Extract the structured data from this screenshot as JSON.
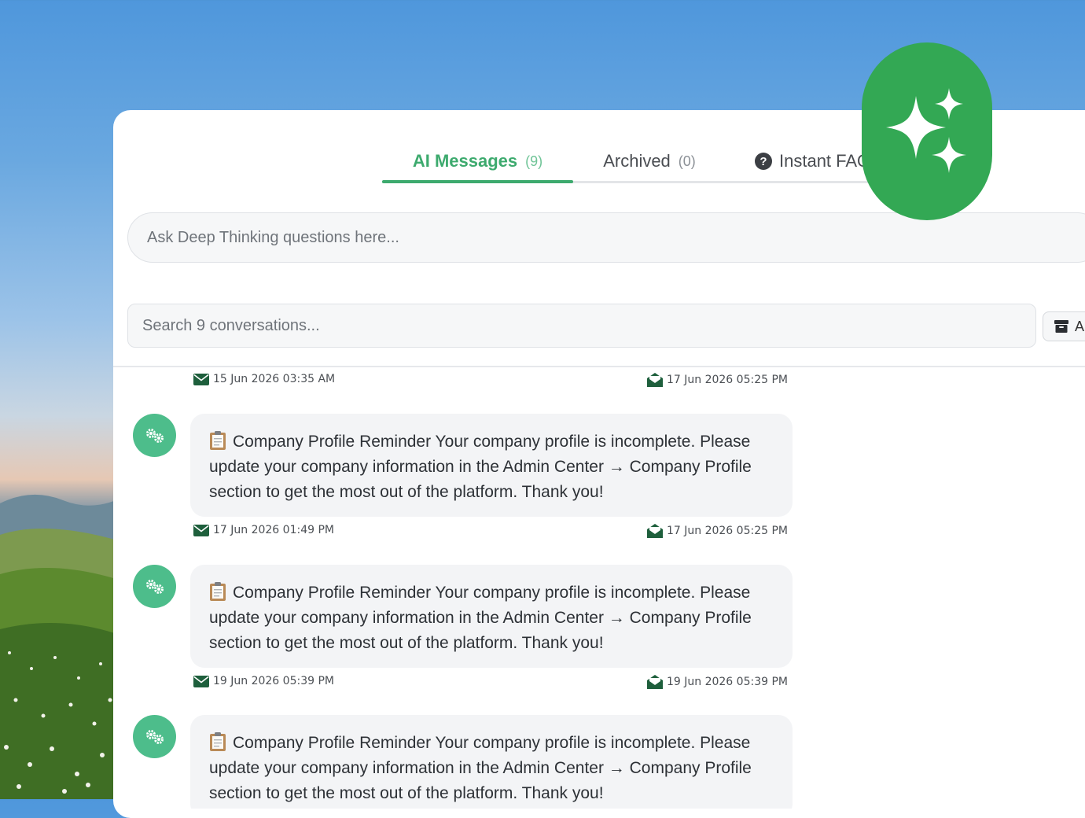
{
  "tabs": [
    {
      "label": "AI Messages",
      "count": "(9)"
    },
    {
      "label": "Archived",
      "count": "(0)"
    },
    {
      "label": "Instant FAQ"
    }
  ],
  "ask": {
    "placeholder": "Ask Deep Thinking questions here..."
  },
  "search": {
    "placeholder": "Search 9 conversations..."
  },
  "archive_button": {
    "label": "A"
  },
  "messages": [
    {
      "sent": "15 Jun 2026 03:35 AM",
      "read": "17 Jun 2026 05:25 PM"
    },
    {
      "text": "Company Profile Reminder Your company profile is incomplete. Please update your company information in the Admin Center → Company Profile section to get the most out of the platform. Thank you!",
      "sent": "17 Jun 2026 01:49 PM",
      "read": "17 Jun 2026 05:25 PM"
    },
    {
      "text": "Company Profile Reminder Your company profile is incomplete. Please update your company information in the Admin Center → Company Profile section to get the most out of the platform. Thank you!",
      "sent": "19 Jun 2026 05:39 PM",
      "read": "19 Jun 2026 05:39 PM"
    },
    {
      "text": "Company Profile Reminder Your company profile is incomplete. Please update your company information in the Admin Center → Company Profile section to get the most out of the platform. Thank you!"
    }
  ],
  "colors": {
    "accent": "#3daa6e",
    "fab": "#33a854",
    "avatar": "#4dbd8b",
    "icon": "#1e5f3c"
  }
}
